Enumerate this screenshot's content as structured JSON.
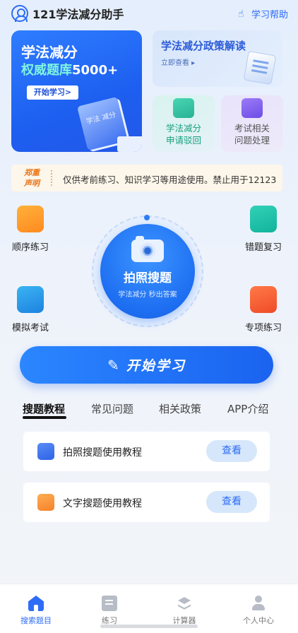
{
  "header": {
    "title": "121学法减分助手",
    "help_label": "学习帮助"
  },
  "banner": {
    "title": "学法减分",
    "subtitle_highlight": "权威题库",
    "subtitle_count": "5000+",
    "button": "开始学习>",
    "book_text": "学法 减分"
  },
  "policy_card": {
    "title": "学法减分政策解读",
    "link": "立即查看 ▸"
  },
  "small_cards": [
    {
      "label_line1": "学法减分",
      "label_line2": "申请驳回"
    },
    {
      "label_line1": "考试相关",
      "label_line2": "问题处理"
    }
  ],
  "notice": {
    "tag_line1": "郑重",
    "tag_line2": "声明",
    "text": "仅供考前练习、知识学习等用途使用。禁止用于12123"
  },
  "features": {
    "sequential": "顺序练习",
    "wrong_review": "错题复习",
    "mock_exam": "模拟考试",
    "topic_practice": "专项练习"
  },
  "photo_search": {
    "title": "拍照搜题",
    "subtitle": "学法减分 秒出答案"
  },
  "start_button": {
    "label": "开始学习"
  },
  "tabs": [
    "搜题教程",
    "常见问题",
    "相关政策",
    "APP介绍"
  ],
  "tutorials": [
    {
      "label": "拍照搜题使用教程",
      "button": "查看"
    },
    {
      "label": "文字搜题使用教程",
      "button": "查看"
    }
  ],
  "bottom_nav": [
    "搜索题目",
    "练习",
    "计算器",
    "个人中心"
  ],
  "colors": {
    "primary": "#2d6cf6",
    "accent_orange": "#e8761b"
  }
}
